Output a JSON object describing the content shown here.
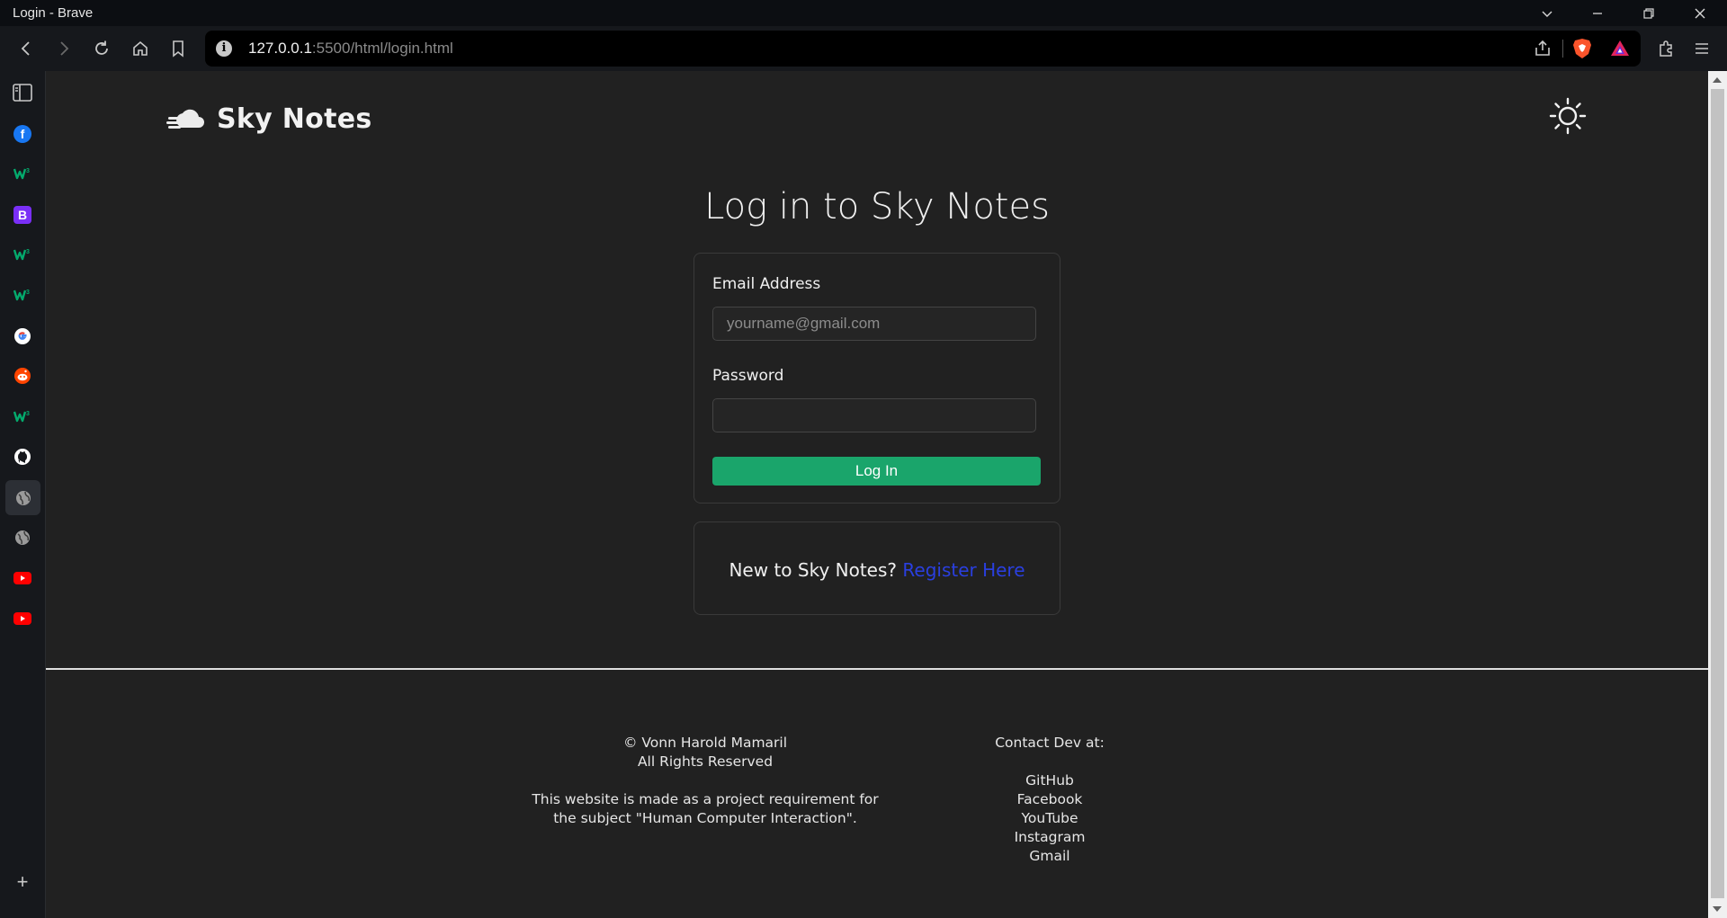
{
  "window": {
    "title": "Login - Brave"
  },
  "toolbar": {
    "url_host": "127.0.0.1",
    "url_rest": ":5500/html/login.html"
  },
  "sidebar": {
    "items": [
      {
        "name": "sidebar-panel-icon"
      },
      {
        "name": "facebook-favicon",
        "color": "#1877f2",
        "glyph": "f"
      },
      {
        "name": "w3schools-favicon",
        "color": "#04aa6d",
        "glyph": "w"
      },
      {
        "name": "bootstrap-favicon",
        "color": "#7a2ff7",
        "glyph": "B"
      },
      {
        "name": "w3schools-favicon",
        "color": "#04aa6d",
        "glyph": "w"
      },
      {
        "name": "w3schools-favicon",
        "color": "#04aa6d",
        "glyph": "w"
      },
      {
        "name": "google-favicon",
        "color": "#ffffff",
        "glyph": "G"
      },
      {
        "name": "reddit-favicon",
        "color": "#ff4500",
        "glyph": "r"
      },
      {
        "name": "w3schools-favicon",
        "color": "#04aa6d",
        "glyph": "w"
      },
      {
        "name": "github-favicon",
        "color": "#ffffff",
        "glyph": "gh"
      },
      {
        "name": "globe-favicon",
        "color": "#9a9a9a",
        "glyph": "globe"
      },
      {
        "name": "globe-favicon",
        "color": "#9a9a9a",
        "glyph": "globe"
      },
      {
        "name": "youtube-favicon",
        "color": "#ff0000",
        "glyph": "yt"
      },
      {
        "name": "youtube-favicon",
        "color": "#ff0000",
        "glyph": "yt"
      }
    ],
    "add_label": "+"
  },
  "page": {
    "brand": "Sky Notes",
    "heading": "Log in to Sky Notes",
    "email_label": "Email Address",
    "email_placeholder": "yourname@gmail.com",
    "password_label": "Password",
    "login_button": "Log In",
    "register_prompt": "New to Sky Notes?",
    "register_link": "Register Here"
  },
  "footer": {
    "copyright": "© Vonn Harold Mamaril",
    "rights": "All Rights Reserved",
    "note": "This website is made as a project requirement for the subject \"Human Computer Interaction\".",
    "contact_title": "Contact Dev at:",
    "links": [
      "GitHub",
      "Facebook",
      "YouTube",
      "Instagram",
      "Gmail"
    ]
  },
  "colors": {
    "accent_green": "#1aa56b",
    "link_blue": "#2a3fe0",
    "page_bg": "#212121"
  }
}
